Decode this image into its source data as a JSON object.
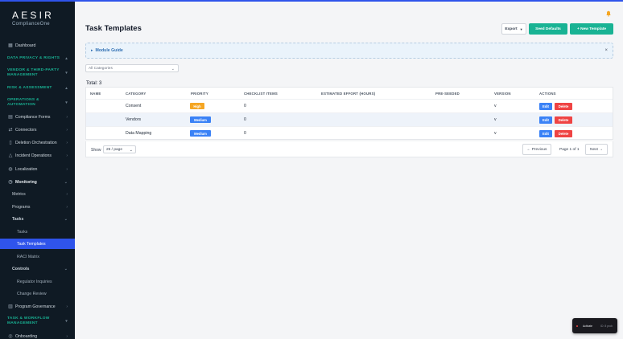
{
  "app": {
    "brand": "AESIR",
    "brand_sub": "ComplianceOne"
  },
  "sidebar": {
    "items": [
      {
        "label": "Dashboard",
        "icon": "grid-icon"
      },
      {
        "label": "DATA PRIVACY & RIGHTS"
      },
      {
        "label": "VENDOR & THIRD-PARTY MANAGEMENT"
      },
      {
        "label": "RISK & ASSESSMENT"
      },
      {
        "label": "OPERATIONS & AUTOMATION"
      },
      {
        "label": "Compliance Forms",
        "icon": "document-icon"
      },
      {
        "label": "Connectors",
        "icon": "plug-icon"
      },
      {
        "label": "Deletion Orchestration",
        "icon": "trash-icon"
      },
      {
        "label": "Incident Operations",
        "icon": "alert-icon"
      },
      {
        "label": "Localization",
        "icon": "globe-icon"
      },
      {
        "label": "Monitoring",
        "icon": "clock-icon"
      },
      {
        "label": "Metrics"
      },
      {
        "label": "Programs"
      },
      {
        "label": "Tasks"
      },
      {
        "label": "Tasks"
      },
      {
        "label": "Task Templates"
      },
      {
        "label": "RACI Matrix"
      },
      {
        "label": "Controls"
      },
      {
        "label": "Regulator Inquiries"
      },
      {
        "label": "Change Review"
      },
      {
        "label": "Program Governance",
        "icon": "chart-icon"
      },
      {
        "label": "TASK & WORKFLOW MANAGEMENT"
      },
      {
        "label": "Onboarding",
        "icon": "compass-icon"
      }
    ]
  },
  "header": {
    "title": "Task Templates",
    "export_label": "Export",
    "seed_label": "Seed Defaults",
    "new_label": "+ New Template"
  },
  "guide": {
    "label": "Module Guide",
    "close": "×"
  },
  "filter": {
    "value": "All Categories"
  },
  "table": {
    "total": "Total: 3",
    "columns": [
      "NAME",
      "CATEGORY",
      "PRIORITY",
      "CHECKLIST ITEMS",
      "ESTIMATED EFFORT (HOURS)",
      "PRE-SEEDED",
      "VERSION",
      "ACTIONS"
    ],
    "rows": [
      {
        "name": "",
        "category": "Consent",
        "priority": "High",
        "checklist": "0",
        "effort": "",
        "preseeded": "",
        "version": "v",
        "edit": "Edit",
        "delete": "Delete"
      },
      {
        "name": "",
        "category": "Vendors",
        "priority": "Medium",
        "checklist": "0",
        "effort": "",
        "preseeded": "",
        "version": "v",
        "edit": "Edit",
        "delete": "Delete"
      },
      {
        "name": "",
        "category": "Data Mapping",
        "priority": "Medium",
        "checklist": "0",
        "effort": "",
        "preseeded": "",
        "version": "v",
        "edit": "Edit",
        "delete": "Delete"
      }
    ]
  },
  "pager": {
    "show_label": "Show",
    "per_page": "25 / page",
    "prev_label": "← Previous",
    "page_info": "Page 1 of 1",
    "next_label": "Next →"
  },
  "toast": {
    "label": "Activate",
    "meta": "ID: 8 prob"
  },
  "colors": {
    "accent": "#19b394",
    "sidebar_bg": "#0f1a24",
    "active_blue": "#2f54eb",
    "priority_high": "#f5a623",
    "priority_medium": "#3b82f6",
    "edit": "#3b82f6",
    "delete": "#ef4444"
  }
}
